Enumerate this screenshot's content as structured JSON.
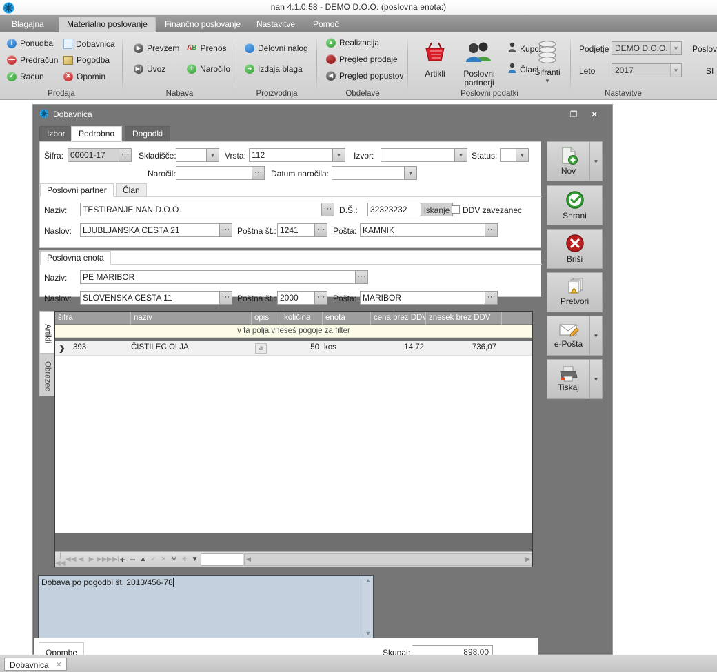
{
  "titlebar": {
    "text": "nan 4.1.0.58 - DEMO D.O.O. (poslovna enota:)"
  },
  "ribbon_tabs": [
    {
      "label": "Blagajna",
      "active": false
    },
    {
      "label": "Materialno poslovanje",
      "active": true
    },
    {
      "label": "Finančno poslovanje",
      "active": false
    },
    {
      "label": "Nastavitve",
      "active": false
    },
    {
      "label": "Pomoč",
      "active": false
    }
  ],
  "ribbon_groups": [
    {
      "label": "Prodaja",
      "items": [
        {
          "label": "Ponudba",
          "icon": "info-circle-icon",
          "color": "#1f6fc4"
        },
        {
          "label": "Dobavnica",
          "icon": "document-icon",
          "color": "#cfe4f7"
        },
        {
          "label": "Predračun",
          "icon": "minus-circle-icon",
          "color": "#c32727"
        },
        {
          "label": "Pogodba",
          "icon": "contract-icon",
          "color": "#c8b06a"
        },
        {
          "label": "Račun",
          "icon": "check-circle-icon",
          "color": "#2f9e2f"
        },
        {
          "label": "Opomin",
          "icon": "cross-circle-icon",
          "color": "#c32727"
        }
      ]
    },
    {
      "label": "Nabava",
      "items": [
        {
          "label": "Prevzem",
          "icon": "play-circle-icon",
          "color": "#4a4a4a"
        },
        {
          "label": "Prenos",
          "icon": "ab-transfer-icon",
          "color": "#2f9e2f"
        },
        {
          "label": "Uvoz",
          "icon": "import-circle-icon",
          "color": "#4a4a4a"
        },
        {
          "label": "Naročilo",
          "icon": "plus-circle-icon",
          "color": "#2f9e2f"
        }
      ]
    },
    {
      "label": "Proizvodnja",
      "items": [
        {
          "label": "Delovni nalog",
          "icon": "blue-circle-icon",
          "color": "#1f6fc4"
        },
        {
          "label": "Izdaja blaga",
          "icon": "arrow-right-circle-icon",
          "color": "#2f9e2f"
        }
      ]
    },
    {
      "label": "Obdelave",
      "items": [
        {
          "label": "Realizacija",
          "icon": "arrow-up-circle-icon",
          "color": "#2f9e2f"
        },
        {
          "label": "Pregled prodaje",
          "icon": "red-circle-icon",
          "color": "#9e1b1b"
        },
        {
          "label": "Pregled popustov",
          "icon": "arrow-left-circle-icon",
          "color": "#4a4a4a"
        }
      ]
    },
    {
      "label": "Poslovni podatki",
      "big_items": [
        {
          "label": "Artikli",
          "icon": "basket-icon"
        },
        {
          "label": "Poslovni\npartnerji",
          "icon": "people-icon"
        },
        {
          "label": "Šifranti",
          "icon": "database-icon",
          "has_dropdown": true
        }
      ],
      "items": [
        {
          "label": "Kupci",
          "icon": "person-dark-icon",
          "color": "#4a4a4a"
        },
        {
          "label": "Člani",
          "icon": "person-blue-icon",
          "color": "#1f6fc4"
        }
      ]
    },
    {
      "label": "Nastavitve",
      "fields": [
        {
          "label": "Podjetje",
          "value": "DEMO D.O.O."
        },
        {
          "label": "Leto",
          "value": "2017"
        }
      ],
      "cut_labels": [
        "Poslovn",
        "SI"
      ]
    }
  ],
  "window": {
    "title": "Dobavnica",
    "icon": "snowflake-icon",
    "buttons": {
      "maximize": "❐",
      "close": "✕"
    },
    "tabs": [
      {
        "label": "Izbor",
        "active": false
      },
      {
        "label": "Podrobno",
        "active": true
      },
      {
        "label": "Dogodki",
        "active": false
      }
    ]
  },
  "form": {
    "sifra": {
      "label": "Šifra:",
      "value": "00001-17"
    },
    "skladisce": {
      "label": "Skladišče:",
      "value": ""
    },
    "vrsta": {
      "label": "Vrsta:",
      "value": "112"
    },
    "izvor": {
      "label": "Izvor:",
      "value": ""
    },
    "status": {
      "label": "Status:",
      "value": ""
    },
    "narocilo": {
      "label": "Naročilo:",
      "value": ""
    },
    "datum_narocila": {
      "label": "Datum naročila:",
      "value": ""
    },
    "partner_tabs": [
      {
        "label": "Poslovni partner",
        "active": true
      },
      {
        "label": "Član",
        "active": false
      }
    ],
    "partner": {
      "naziv": {
        "label": "Naziv:",
        "value": "TESTIRANJE NAN D.O.O."
      },
      "ds": {
        "label": "D.Š.:",
        "value": "32323232"
      },
      "iskanje": {
        "label": "iskanje"
      },
      "ddv": {
        "label": "DDV zavezanec",
        "checked": false
      },
      "naslov": {
        "label": "Naslov:",
        "value": "LJUBLJANSKA CESTA 21"
      },
      "postna_st": {
        "label": "Poštna št.:",
        "value": "1241"
      },
      "posta": {
        "label": "Pošta:",
        "value": "KAMNIK"
      }
    },
    "unit_tab": {
      "label": "Poslovna enota",
      "active": true
    },
    "unit": {
      "naziv": {
        "label": "Naziv:",
        "value": "PE MARIBOR"
      },
      "naslov": {
        "label": "Naslov:",
        "value": "SLOVENSKA CESTA 11"
      },
      "postna_st": {
        "label": "Poštna št.:",
        "value": "2000"
      },
      "posta": {
        "label": "Pošta:",
        "value": "MARIBOR"
      }
    }
  },
  "grid": {
    "side_tabs": [
      {
        "label": "Artikli",
        "active": true
      },
      {
        "label": "Obrazec",
        "active": false
      }
    ],
    "columns": [
      "šifra",
      "naziv",
      "opis",
      "količina",
      "enota",
      "cena brez DDV",
      "znesek brez DDV"
    ],
    "filter_hint": "v ta polja vneseš pogoje za filter",
    "rows": [
      {
        "sifra": "393",
        "naziv": "ČISTILEC OLJA",
        "opis": "a",
        "kolicina": "50",
        "enota": "kos",
        "cena": "14,72",
        "znesek": "736,07"
      }
    ],
    "nav_icons": [
      "first-record-icon",
      "prior-page-icon",
      "prior-record-icon",
      "next-record-icon",
      "next-page-icon",
      "last-record-icon",
      "insert-record-icon",
      "delete-record-icon",
      "edit-record-icon",
      "post-edit-icon",
      "cancel-edit-icon",
      "refresh-icon",
      "apply-update-icon",
      "filter-icon"
    ],
    "nav_box_value": ""
  },
  "memo": {
    "value": "Dobava po pogodbi št. 2013/456-78",
    "tab_label": "Opombe"
  },
  "total": {
    "label": "Skupaj:",
    "value": "898,00"
  },
  "taskbar": {
    "item_label": "Dobavnica",
    "close_glyph": "✕"
  }
}
